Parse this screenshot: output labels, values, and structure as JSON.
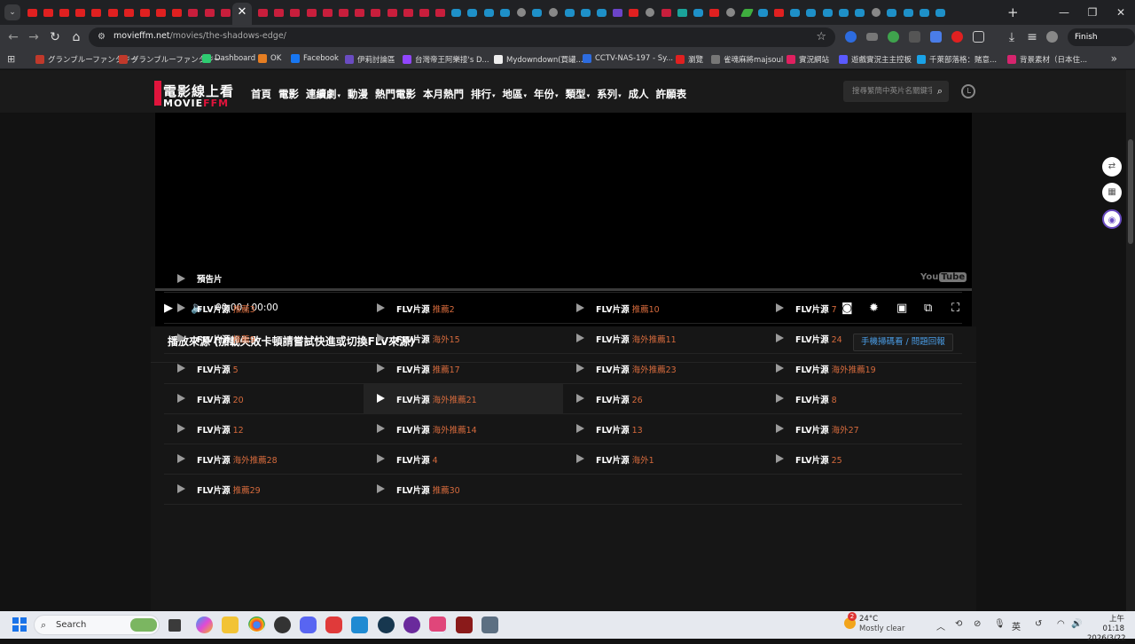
{
  "browser": {
    "active_tab_close": "✕",
    "new_tab": "+",
    "window_controls": [
      "—",
      "❐",
      "✕"
    ],
    "url_host": "movieffm.net",
    "url_path": "/movies/the-shadows-edge/",
    "finish_update": "Finish update",
    "bookmarks": [
      {
        "label": "グランブルーファンタジー",
        "color": "#c0392b"
      },
      {
        "label": "グランブルーファンタジー",
        "color": "#c0392b"
      },
      {
        "label": "Dashboard",
        "color": "#2ecc71"
      },
      {
        "label": "OK",
        "color": "#e67e22"
      },
      {
        "label": "Facebook",
        "color": "#1877f2"
      },
      {
        "label": "伊莉討論區",
        "color": "#6a4cc2"
      },
      {
        "label": "台灣帝王阿樂接's D...",
        "color": "#9146ff"
      },
      {
        "label": "Mydowndown(買罐...",
        "color": "#eeeeee"
      },
      {
        "label": "CCTV-NAS-197 - Sy...",
        "color": "#2d6cdf"
      },
      {
        "label": "瀏覽",
        "color": "#e02020"
      },
      {
        "label": "雀魂麻將majsoul",
        "color": "#777777"
      },
      {
        "label": "實況網站",
        "color": "#e02060"
      },
      {
        "label": "遊戲實況主主控板",
        "color": "#5a5aff"
      },
      {
        "label": "千萊部落格：賭意...",
        "color": "#1aa3e8"
      },
      {
        "label": "背景素材（日本住...",
        "color": "#d6246e"
      }
    ]
  },
  "site": {
    "logo_cn": "電影線上看",
    "logo_en_prefix": "MOVIE",
    "logo_en_suffix": "FFM",
    "menu": [
      {
        "label": "首頁",
        "dropdown": false
      },
      {
        "label": "電影",
        "dropdown": false
      },
      {
        "label": "連續劇",
        "dropdown": true
      },
      {
        "label": "動漫",
        "dropdown": false
      },
      {
        "label": "熱門電影",
        "dropdown": false
      },
      {
        "label": "本月熱門",
        "dropdown": false
      },
      {
        "label": "排行",
        "dropdown": true
      },
      {
        "label": "地區",
        "dropdown": true
      },
      {
        "label": "年份",
        "dropdown": true
      },
      {
        "label": "類型",
        "dropdown": true
      },
      {
        "label": "系列",
        "dropdown": true
      },
      {
        "label": "成人",
        "dropdown": false
      },
      {
        "label": "許願表",
        "dropdown": false
      }
    ],
    "search_placeholder": "搜尋繁簡中英片名關鍵字"
  },
  "player": {
    "time": "00:00 / 00:00"
  },
  "sources_panel": {
    "title": "播放來源 (加載失敗卡頓請嘗試快進或切換FLV來源)",
    "report_button": "手機掃碼看 / 問題回報",
    "trailer_label": "預告片",
    "youtube_logo_you": "You",
    "youtube_logo_tube": "Tube",
    "source_prefix": "FLV片源",
    "rows": [
      [
        "推薦3",
        "推薦2",
        "推薦10",
        "7"
      ],
      [
        "推薦9",
        "海外15",
        "海外推薦11",
        "24"
      ],
      [
        "5",
        "推薦17",
        "海外推薦23",
        "海外推薦19"
      ],
      [
        "20",
        "海外推薦21",
        "26",
        "8"
      ],
      [
        "12",
        "海外推薦14",
        "13",
        "海外27"
      ],
      [
        "海外推薦28",
        "4",
        "海外1",
        "25"
      ],
      [
        "推薦29",
        "推薦30"
      ]
    ],
    "active_source": "海外推薦21"
  },
  "taskbar": {
    "search_label": "Search",
    "weather_temp": "24°C",
    "weather_condition": "Mostly clear",
    "weather_badge": "2",
    "ime": "英",
    "clock_time": "上午 01:18",
    "clock_date": "2026/3/22"
  }
}
